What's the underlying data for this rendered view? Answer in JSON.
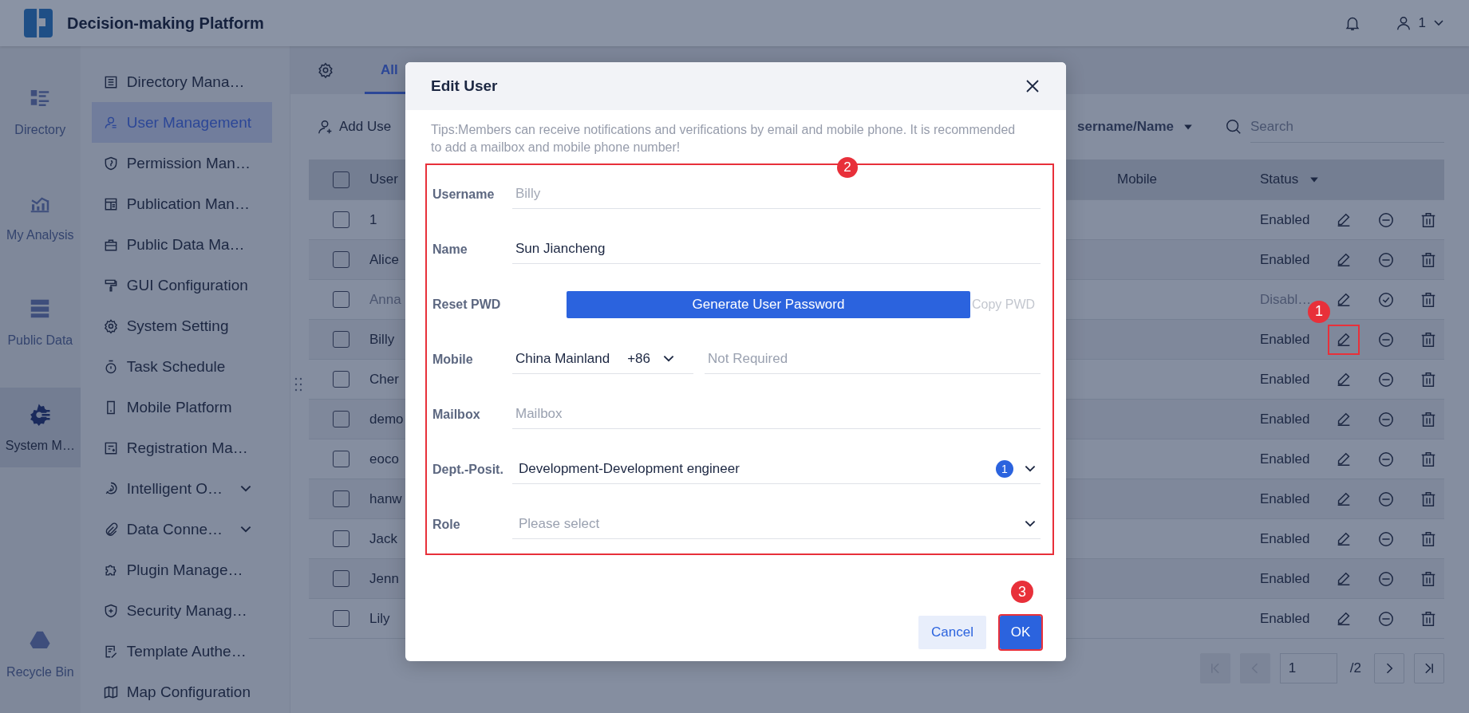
{
  "header": {
    "title": "Decision-making Platform",
    "user": "1"
  },
  "rail": [
    {
      "label": "Directory",
      "selected": false
    },
    {
      "label": "My Analysis",
      "selected": false
    },
    {
      "label": "Public Data",
      "selected": false
    },
    {
      "label": "System M…",
      "selected": true
    },
    {
      "label": "Recycle Bin",
      "selected": false
    }
  ],
  "sidebar": {
    "items": [
      {
        "label": "Directory Mana…",
        "selected": false,
        "collapsible": false
      },
      {
        "label": "User Management",
        "selected": true,
        "collapsible": false
      },
      {
        "label": "Permission Man…",
        "selected": false,
        "collapsible": false
      },
      {
        "label": "Publication Man…",
        "selected": false,
        "collapsible": false
      },
      {
        "label": "Public Data Ma…",
        "selected": false,
        "collapsible": false
      },
      {
        "label": "GUI Configuration",
        "selected": false,
        "collapsible": false
      },
      {
        "label": "System Setting",
        "selected": false,
        "collapsible": false
      },
      {
        "label": "Task Schedule",
        "selected": false,
        "collapsible": false
      },
      {
        "label": "Mobile Platform",
        "selected": false,
        "collapsible": false
      },
      {
        "label": "Registration Ma…",
        "selected": false,
        "collapsible": false
      },
      {
        "label": "Intelligent O…",
        "selected": false,
        "collapsible": true
      },
      {
        "label": "Data Conne…",
        "selected": false,
        "collapsible": true
      },
      {
        "label": "Plugin Manage…",
        "selected": false,
        "collapsible": false
      },
      {
        "label": "Security Manag…",
        "selected": false,
        "collapsible": false
      },
      {
        "label": "Template Authe…",
        "selected": false,
        "collapsible": false
      },
      {
        "label": "Map Configuration",
        "selected": false,
        "collapsible": false
      }
    ]
  },
  "tabs": [
    {
      "label": "All",
      "selected": true
    }
  ],
  "toolbar": {
    "add_button": "Add Use",
    "filter": "sername/Name",
    "search": {
      "placeholder": "Search"
    }
  },
  "table": {
    "columns": [
      "User",
      "Mobile",
      "Status"
    ],
    "header_checked": false,
    "rows": [
      {
        "username": "1",
        "status": "Enabled",
        "enabled": true,
        "checked": false,
        "highlighted": false
      },
      {
        "username": "Alice",
        "status": "Enabled",
        "enabled": true,
        "checked": false,
        "highlighted": false
      },
      {
        "username": "Anna",
        "status": "Disabl…",
        "enabled": false,
        "checked": false,
        "highlighted": false
      },
      {
        "username": "Billy",
        "status": "Enabled",
        "enabled": true,
        "checked": false,
        "highlighted": true,
        "badge": "1"
      },
      {
        "username": "Cher",
        "status": "Enabled",
        "enabled": true,
        "checked": false,
        "highlighted": false
      },
      {
        "username": "demo",
        "status": "Enabled",
        "enabled": true,
        "checked": false,
        "highlighted": false
      },
      {
        "username": "eoco",
        "status": "Enabled",
        "enabled": true,
        "checked": false,
        "highlighted": false
      },
      {
        "username": "hanw",
        "status": "Enabled",
        "enabled": true,
        "checked": false,
        "highlighted": false
      },
      {
        "username": "Jack",
        "status": "Enabled",
        "enabled": true,
        "checked": false,
        "highlighted": false
      },
      {
        "username": "Jenn",
        "status": "Enabled",
        "enabled": true,
        "checked": false,
        "highlighted": false
      },
      {
        "username": "Lily",
        "status": "Enabled",
        "enabled": true,
        "checked": false,
        "highlighted": false
      }
    ]
  },
  "pagination": {
    "page": "1",
    "total": "/2",
    "first": {
      "disabled": true
    },
    "prev": {
      "disabled": true
    },
    "next": {
      "disabled": false
    },
    "last": {
      "disabled": false
    }
  },
  "dialog": {
    "title": "Edit User",
    "tips": "Tips:Members can receive notifications and verifications by email and mobile phone. It is recommended to add a mailbox and mobile phone number!",
    "tips_badge": "2",
    "highlighted": true,
    "fields": [
      {
        "kind": "readonly",
        "label": "Username",
        "value": "Billy"
      },
      {
        "kind": "text",
        "label": "Name",
        "value": "Sun Jiancheng"
      },
      {
        "kind": "password",
        "label": "Reset PWD",
        "button": "Generate User Password",
        "link": "Copy PWD"
      },
      {
        "kind": "phone",
        "label": "Mobile",
        "region": "China Mainland",
        "code": "+86",
        "placeholder": "Not Required"
      },
      {
        "kind": "text",
        "label": "Mailbox",
        "placeholder": "Mailbox"
      },
      {
        "kind": "select",
        "label": "Dept.-Posit.",
        "value": "Development-Development engineer",
        "count": "1"
      },
      {
        "kind": "select",
        "label": "Role",
        "placeholder": "Please select"
      }
    ],
    "cancel": "Cancel",
    "ok": {
      "label": "OK",
      "highlighted": true,
      "badge": "3"
    }
  }
}
